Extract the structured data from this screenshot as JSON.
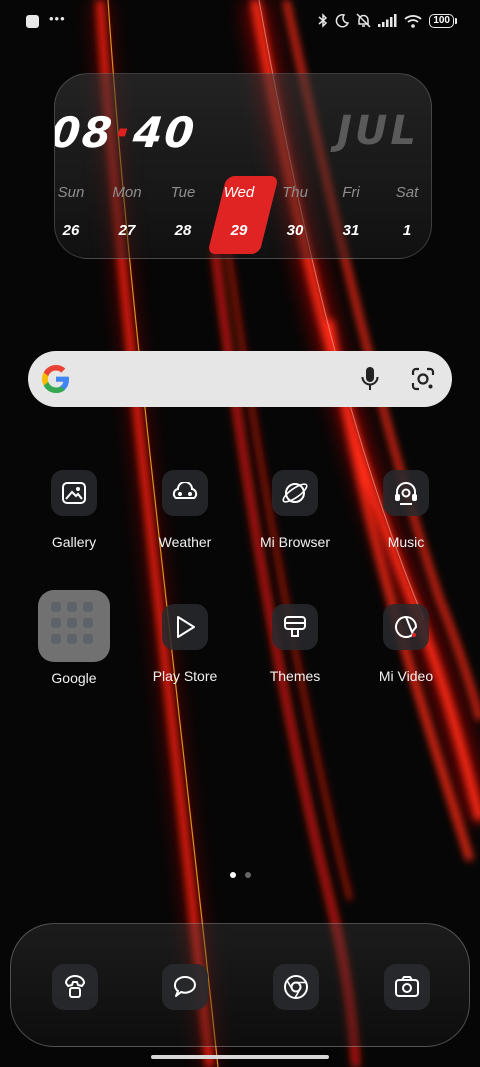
{
  "colors": {
    "accent": "#e02424",
    "icon_stroke": "#ffffff",
    "search_bg": "#e6e6e6"
  },
  "status_bar": {
    "left_icons": [
      "notification-square-icon",
      "more-dots-icon"
    ],
    "right_icons": [
      "bluetooth-icon",
      "do-not-disturb-moon-icon",
      "muted-bell-icon",
      "signal-icon",
      "wifi-icon"
    ],
    "battery": "100"
  },
  "widget": {
    "hour": "08",
    "minute": "40",
    "month": "JUL",
    "days": [
      {
        "name": "Sun",
        "num": "26"
      },
      {
        "name": "Mon",
        "num": "27"
      },
      {
        "name": "Tue",
        "num": "28"
      },
      {
        "name": "Wed",
        "num": "29"
      },
      {
        "name": "Thu",
        "num": "30"
      },
      {
        "name": "Fri",
        "num": "31"
      },
      {
        "name": "Sat",
        "num": "1"
      }
    ],
    "selected_day": "Wed"
  },
  "search": {
    "icons": [
      "google-g-icon",
      "microphone-icon",
      "google-lens-icon"
    ]
  },
  "apps": {
    "gallery": "Gallery",
    "weather": "Weather",
    "mi_browser": "Mi Browser",
    "music": "Music",
    "google_folder": "Google",
    "play_store": "Play Store",
    "themes": "Themes",
    "mi_video": "Mi Video"
  },
  "pages": {
    "current": 1,
    "total": 2
  },
  "dock": {
    "icons": [
      "phone-icon",
      "messages-icon",
      "chrome-icon",
      "camera-icon"
    ]
  }
}
